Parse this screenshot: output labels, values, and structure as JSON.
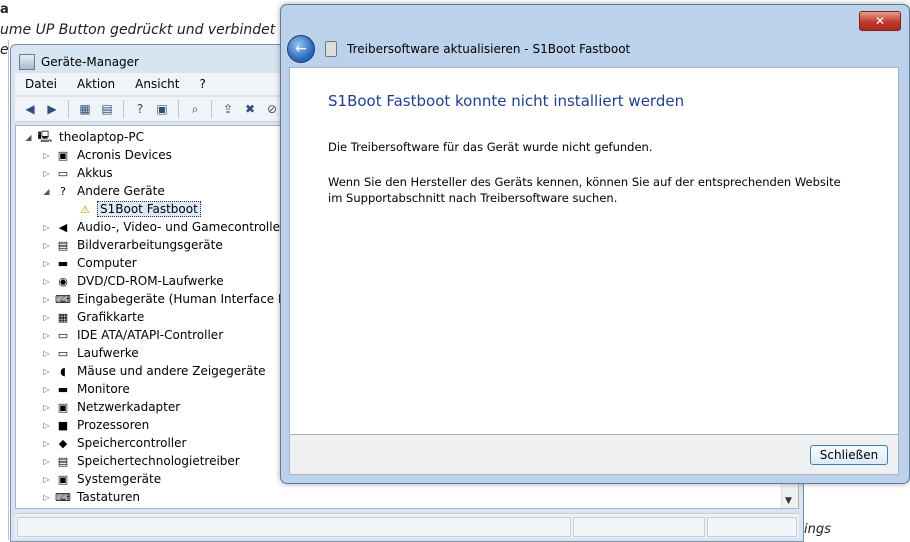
{
  "background": {
    "lines": [
      "a",
      "ume UP Button gedrückt und verbindet das",
      "e"
    ],
    "bottom_right_fragment": "ings"
  },
  "device_manager": {
    "title": "Geräte-Manager",
    "menu": [
      "Datei",
      "Aktion",
      "Ansicht",
      "?"
    ],
    "root": "theolaptop-PC",
    "nodes": [
      {
        "label": "Acronis Devices",
        "icon": "acronis-device-icon",
        "exp": "▷"
      },
      {
        "label": "Akkus",
        "icon": "battery-icon",
        "exp": "▷"
      },
      {
        "label": "Andere Geräte",
        "icon": "unknown-device-icon",
        "exp": "◢"
      },
      {
        "label": "S1Boot Fastboot",
        "icon": "warning-device-icon",
        "exp": ""
      },
      {
        "label": "Audio-, Video- und Gamecontroller",
        "icon": "speaker-icon",
        "exp": "▷"
      },
      {
        "label": "Bildverarbeitungsgeräte",
        "icon": "camera-icon",
        "exp": "▷"
      },
      {
        "label": "Computer",
        "icon": "computer-icon",
        "exp": "▷"
      },
      {
        "label": "DVD/CD-ROM-Laufwerke",
        "icon": "dvd-drive-icon",
        "exp": "▷"
      },
      {
        "label": "Eingabegeräte (Human Interface Devic",
        "icon": "hid-icon",
        "exp": "▷"
      },
      {
        "label": "Grafikkarte",
        "icon": "display-adapter-icon",
        "exp": "▷"
      },
      {
        "label": "IDE ATA/ATAPI-Controller",
        "icon": "ide-controller-icon",
        "exp": "▷"
      },
      {
        "label": "Laufwerke",
        "icon": "disk-drive-icon",
        "exp": "▷"
      },
      {
        "label": "Mäuse und andere Zeigegeräte",
        "icon": "mouse-icon",
        "exp": "▷"
      },
      {
        "label": "Monitore",
        "icon": "monitor-icon",
        "exp": "▷"
      },
      {
        "label": "Netzwerkadapter",
        "icon": "network-adapter-icon",
        "exp": "▷"
      },
      {
        "label": "Prozessoren",
        "icon": "processor-icon",
        "exp": "▷"
      },
      {
        "label": "Speichercontroller",
        "icon": "storage-controller-icon",
        "exp": "▷"
      },
      {
        "label": "Speichertechnologietreiber",
        "icon": "storage-tech-icon",
        "exp": "▷"
      },
      {
        "label": "Systemgeräte",
        "icon": "system-device-icon",
        "exp": "▷"
      },
      {
        "label": "Tastaturen",
        "icon": "keyboard-icon",
        "exp": "▷"
      }
    ]
  },
  "dialog": {
    "header_title": "Treibersoftware aktualisieren - S1Boot Fastboot",
    "close_glyph": "✕",
    "back_glyph": "←",
    "main_title": "S1Boot Fastboot konnte nicht installiert werden",
    "paragraph1": "Die Treibersoftware für das Gerät wurde nicht gefunden.",
    "paragraph2": "Wenn Sie den Hersteller des Geräts kennen, können Sie auf der entsprechenden Website im Supportabschnitt nach Treibersoftware suchen.",
    "close_button": "Schließen"
  },
  "colors": {
    "accent_title": "#1f3f8f",
    "window_frame": "#bcd2ea",
    "close_red": "#c0392b"
  }
}
